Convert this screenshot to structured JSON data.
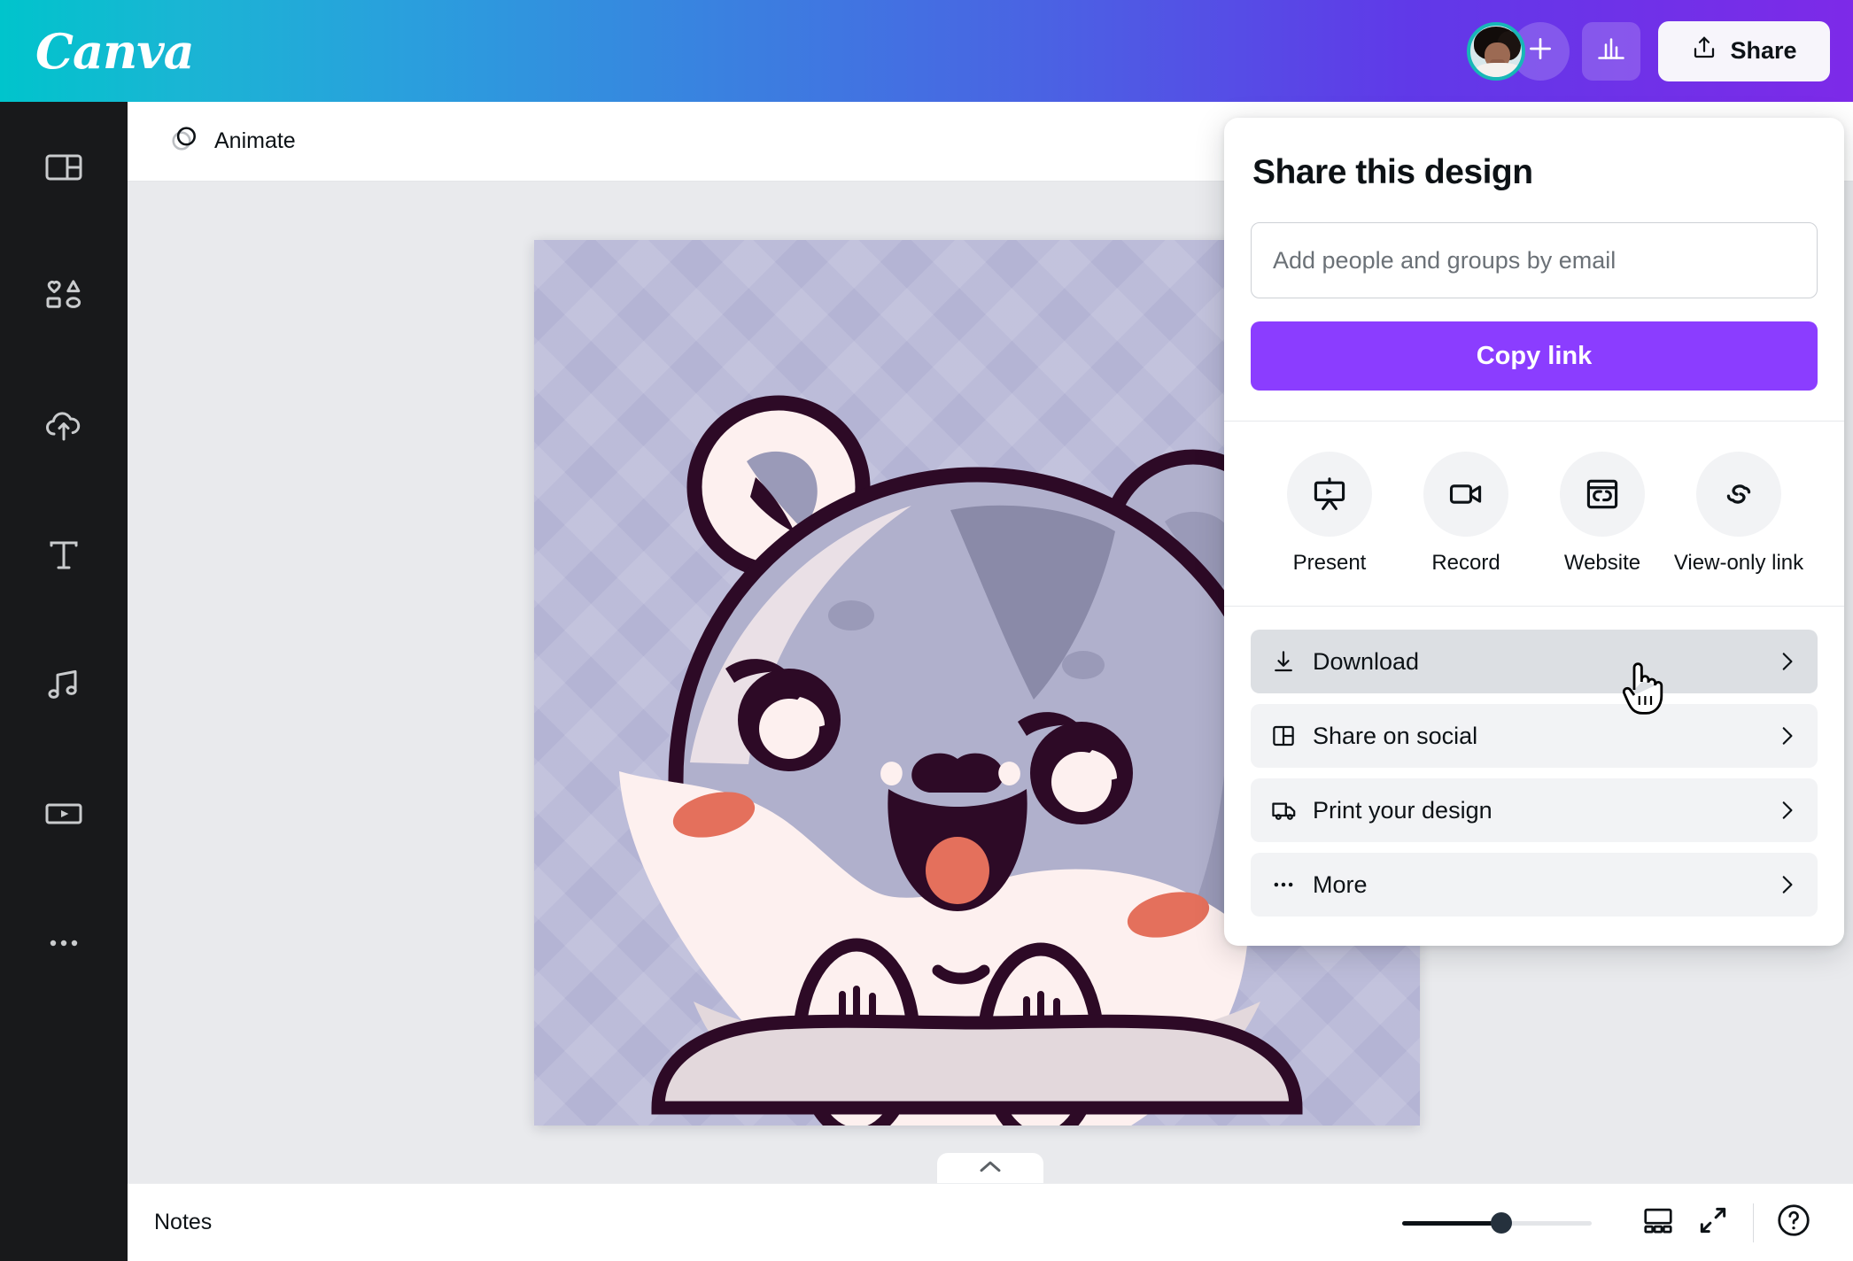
{
  "app": {
    "logo_text": "Canva"
  },
  "topbar": {
    "avatar_name": "user-avatar",
    "add_label": "+",
    "share_label": "Share",
    "icons": {
      "plus": "plus-icon",
      "insights": "bar-chart-icon",
      "share": "share-upload-icon"
    }
  },
  "sidebar": {
    "items": [
      {
        "name": "design",
        "icon": "layout-icon"
      },
      {
        "name": "elements",
        "icon": "shapes-icon"
      },
      {
        "name": "uploads",
        "icon": "cloud-upload-icon"
      },
      {
        "name": "text",
        "icon": "text-t-icon"
      },
      {
        "name": "audio",
        "icon": "music-note-icon"
      },
      {
        "name": "videos",
        "icon": "video-play-icon"
      },
      {
        "name": "more",
        "icon": "ellipsis-icon"
      }
    ]
  },
  "toolbar": {
    "animate_label": "Animate",
    "animate_icon": "animate-circle-icon"
  },
  "canvas": {
    "design_title": "hamster-sticker-design",
    "background_color": "#b4b4d4",
    "pattern": "zigzag",
    "fur_color": "#b0b0cc",
    "fur_shadow_color": "#9a9ab8",
    "cream_color": "#fdf0ef",
    "belly_shadow_color": "#e3d8dc",
    "outline_color": "#2d0a26",
    "blush_color": "#e4705c",
    "tongue_color": "#e4705c"
  },
  "notes": {
    "label": "Notes",
    "collapse_icon": "chevron-up-icon"
  },
  "bottom": {
    "zoom_percent": 52,
    "page_view_icon": "grid-view-icon",
    "fullscreen_icon": "expand-icon",
    "help_icon": "question-mark-icon"
  },
  "share_panel": {
    "title": "Share this design",
    "email_placeholder": "Add people and groups by email",
    "email_value": "",
    "copy_link_label": "Copy link",
    "accent_color": "#8b3dff",
    "quick_actions": [
      {
        "label": "Present",
        "icon": "present-screen-icon"
      },
      {
        "label": "Record",
        "icon": "video-camera-icon"
      },
      {
        "label": "Website",
        "icon": "website-link-icon"
      },
      {
        "label": "View-only link",
        "icon": "view-only-link-icon"
      }
    ],
    "menu_items": [
      {
        "label": "Download",
        "icon": "download-icon",
        "hovered": true
      },
      {
        "label": "Share on social",
        "icon": "share-social-icon",
        "hovered": false
      },
      {
        "label": "Print your design",
        "icon": "print-truck-icon",
        "hovered": false
      },
      {
        "label": "More",
        "icon": "ellipsis-icon",
        "hovered": false
      }
    ]
  }
}
